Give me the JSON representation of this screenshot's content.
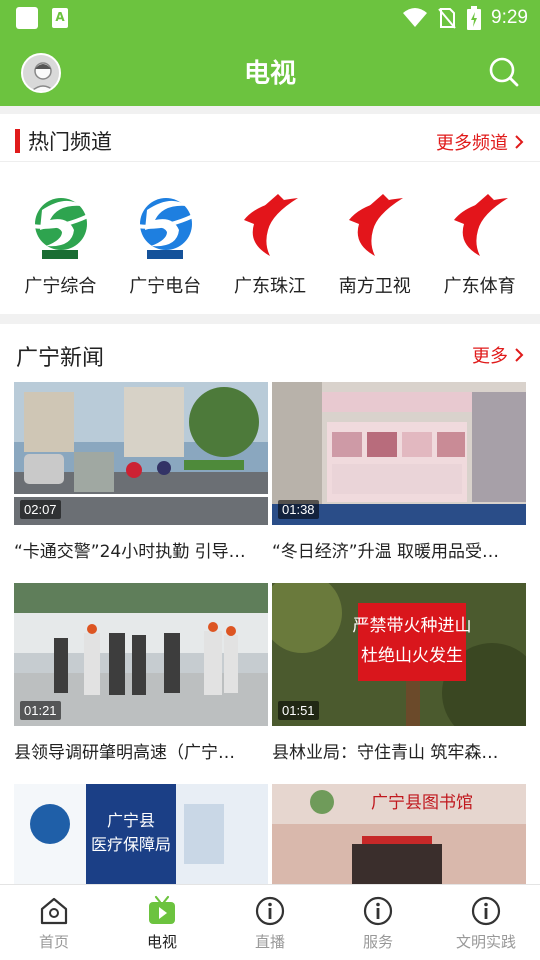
{
  "status_bar": {
    "time": "9:29"
  },
  "app_bar": {
    "title": "电视"
  },
  "hot_channels": {
    "title": "热门频道",
    "more_label": "更多频道",
    "items": [
      {
        "label": "广宁综合",
        "icon": "gnt-green-logo"
      },
      {
        "label": "广宁电台",
        "icon": "gnt-blue-logo"
      },
      {
        "label": "广东珠江",
        "icon": "gdtv-logo"
      },
      {
        "label": "南方卫视",
        "icon": "gdtv-logo"
      },
      {
        "label": "广东体育",
        "icon": "gdtv-logo"
      }
    ]
  },
  "news": {
    "title": "广宁新闻",
    "more_label": "更多",
    "items": [
      {
        "duration": "02:07",
        "caption": "“卡通交警”24小时执勤 引导…"
      },
      {
        "duration": "01:38",
        "caption": "“冬日经济”升温 取暖用品受…"
      },
      {
        "duration": "01:21",
        "caption": "县领导调研肇明高速（广宁…"
      },
      {
        "duration": "01:51",
        "caption": "县林业局：守住青山 筑牢森…"
      },
      {
        "duration": "",
        "caption": ""
      },
      {
        "duration": "",
        "caption": ""
      }
    ]
  },
  "thumb_text": {
    "banner_fire_1": "严禁带火种进山",
    "banner_fire_2": "杜绝山火发生",
    "office_sign_1": "广宁县",
    "office_sign_2": "医疗保障局",
    "library_sign": "广宁县图书馆"
  },
  "tabs": [
    {
      "label": "首页",
      "icon": "home-icon",
      "active": false
    },
    {
      "label": "电视",
      "icon": "tv-icon",
      "active": true
    },
    {
      "label": "直播",
      "icon": "info-icon",
      "active": false
    },
    {
      "label": "服务",
      "icon": "info-icon",
      "active": false
    },
    {
      "label": "文明实践",
      "icon": "info-icon",
      "active": false
    }
  ],
  "colors": {
    "brand_green": "#6cc33f",
    "accent_red": "#e01b1b"
  }
}
